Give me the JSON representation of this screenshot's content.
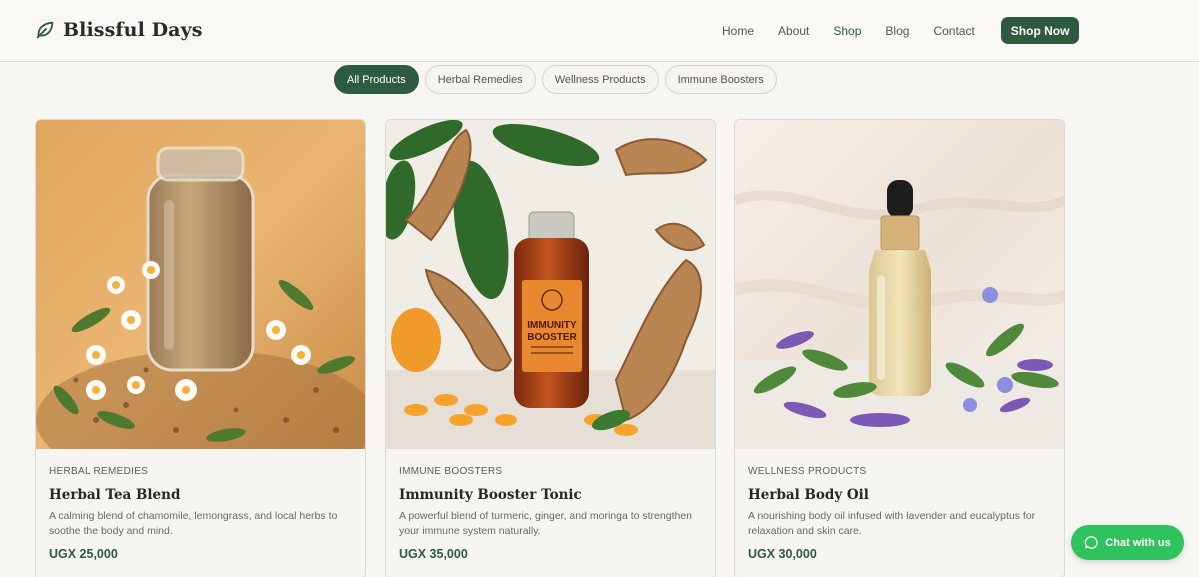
{
  "brand": {
    "name": "Blissful Days",
    "accent": "#2e5b3f",
    "chat_color": "#2fc35e"
  },
  "nav": {
    "items": [
      {
        "label": "Home"
      },
      {
        "label": "About"
      },
      {
        "label": "Shop",
        "active": true
      },
      {
        "label": "Blog"
      },
      {
        "label": "Contact"
      }
    ],
    "cta_label": "Shop Now"
  },
  "filters": {
    "items": [
      {
        "label": "All Products",
        "active": true
      },
      {
        "label": "Herbal Remedies"
      },
      {
        "label": "Wellness Products"
      },
      {
        "label": "Immune Boosters"
      }
    ]
  },
  "products": [
    {
      "category": "HERBAL REMEDIES",
      "name": "Herbal Tea Blend",
      "description": "A calming blend of chamomile, lemongrass, and local herbs to soothe the body and mind.",
      "price": "UGX 25,000"
    },
    {
      "category": "IMMUNE BOOSTERS",
      "name": "Immunity Booster Tonic",
      "description": "A powerful blend of turmeric, ginger, and moringa to strengthen your immune system naturally.",
      "price": "UGX 35,000",
      "bottle_label": [
        "IMMUNITY",
        "BOOSTER"
      ]
    },
    {
      "category": "WELLNESS PRODUCTS",
      "name": "Herbal Body Oil",
      "description": "A nourishing body oil infused with lavender and eucalyptus for relaxation and skin care.",
      "price": "UGX 30,000"
    }
  ],
  "chat": {
    "label": "Chat with us"
  }
}
